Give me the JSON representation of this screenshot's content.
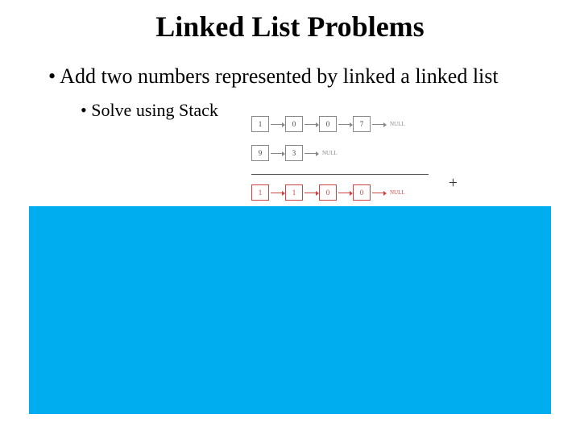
{
  "title": "Linked List Problems",
  "bullets": {
    "b1": "Add two numbers represented by linked a linked list",
    "b2": "Solve using Stack"
  },
  "diagram": {
    "row1": {
      "n0": "1",
      "n1": "0",
      "n2": "0",
      "n3": "7",
      "end": "NULL"
    },
    "row2": {
      "n0": "9",
      "n1": "3",
      "end": "NULL"
    },
    "plus": "+",
    "row3": {
      "n0": "1",
      "n1": "1",
      "n2": "0",
      "n3": "0",
      "end": "NULL"
    }
  }
}
